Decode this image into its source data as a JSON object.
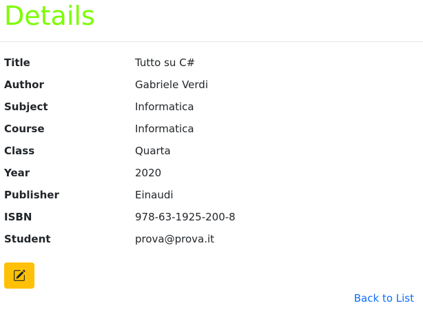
{
  "page": {
    "title": "Details"
  },
  "details": [
    {
      "label": "Title",
      "value": "Tutto su C#"
    },
    {
      "label": "Author",
      "value": "Gabriele Verdi"
    },
    {
      "label": "Subject",
      "value": "Informatica"
    },
    {
      "label": "Course",
      "value": "Informatica"
    },
    {
      "label": "Class",
      "value": "Quarta"
    },
    {
      "label": "Year",
      "value": "2020"
    },
    {
      "label": "Publisher",
      "value": "Einaudi"
    },
    {
      "label": "ISBN",
      "value": "978-63-1925-200-8"
    },
    {
      "label": "Student",
      "value": "prova@prova.it"
    }
  ],
  "actions": {
    "edit_icon": "pencil-square-icon",
    "back_link_label": "Back to List"
  },
  "colors": {
    "title": "#7cfc00",
    "edit_button": "#ffc107",
    "link": "#0d6efd"
  }
}
